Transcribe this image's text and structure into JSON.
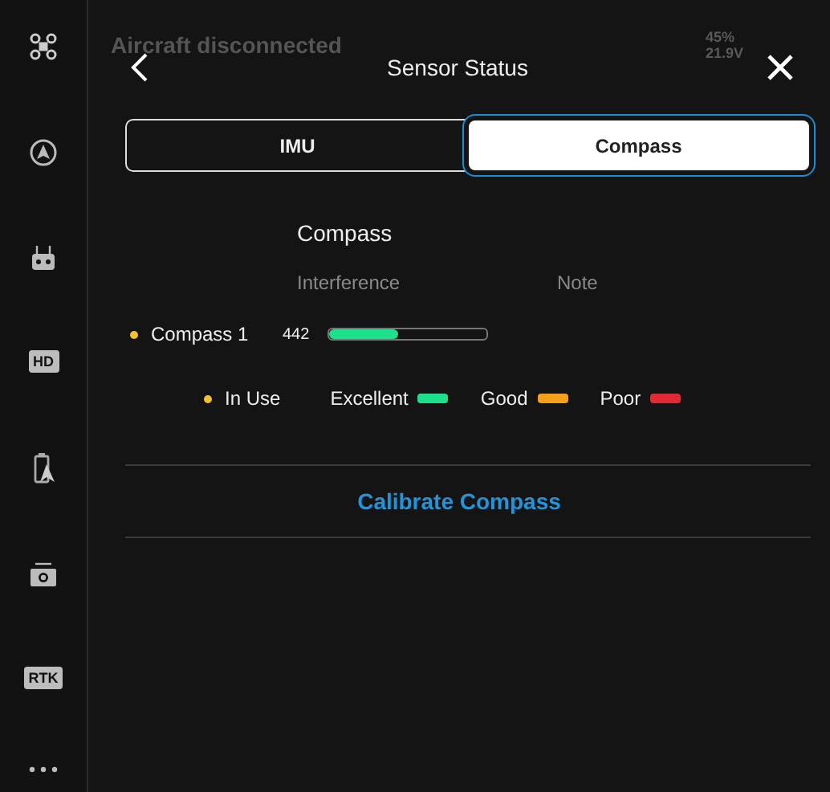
{
  "sidebar": {
    "items": [
      {
        "kind": "drone"
      },
      {
        "kind": "navigation"
      },
      {
        "kind": "controller"
      },
      {
        "kind": "badge",
        "label": "HD"
      },
      {
        "kind": "battery"
      },
      {
        "kind": "camera"
      },
      {
        "kind": "badge",
        "label": "RTK"
      },
      {
        "kind": "more"
      }
    ]
  },
  "status_bar": {
    "title": "Aircraft disconnected",
    "battery_percent": "45%",
    "battery_voltage": "21.9V"
  },
  "dialog": {
    "title": "Sensor Status",
    "tabs": [
      {
        "label": "IMU",
        "selected": false
      },
      {
        "label": "Compass",
        "selected": true
      }
    ],
    "section_title": "Compass",
    "columns": [
      "Interference",
      "Note"
    ],
    "compasses": [
      {
        "name": "Compass 1",
        "in_use": true,
        "reading": "442",
        "level": 0.44,
        "color": "#1ee08c"
      }
    ],
    "legend": [
      {
        "label": "Excellent",
        "color": "#1ee08c"
      },
      {
        "label": "Good",
        "color": "#f5a01a"
      },
      {
        "label": "Poor",
        "color": "#e02a35"
      }
    ],
    "in_use_label": "In Use",
    "calibrate_button": "Calibrate Compass"
  }
}
